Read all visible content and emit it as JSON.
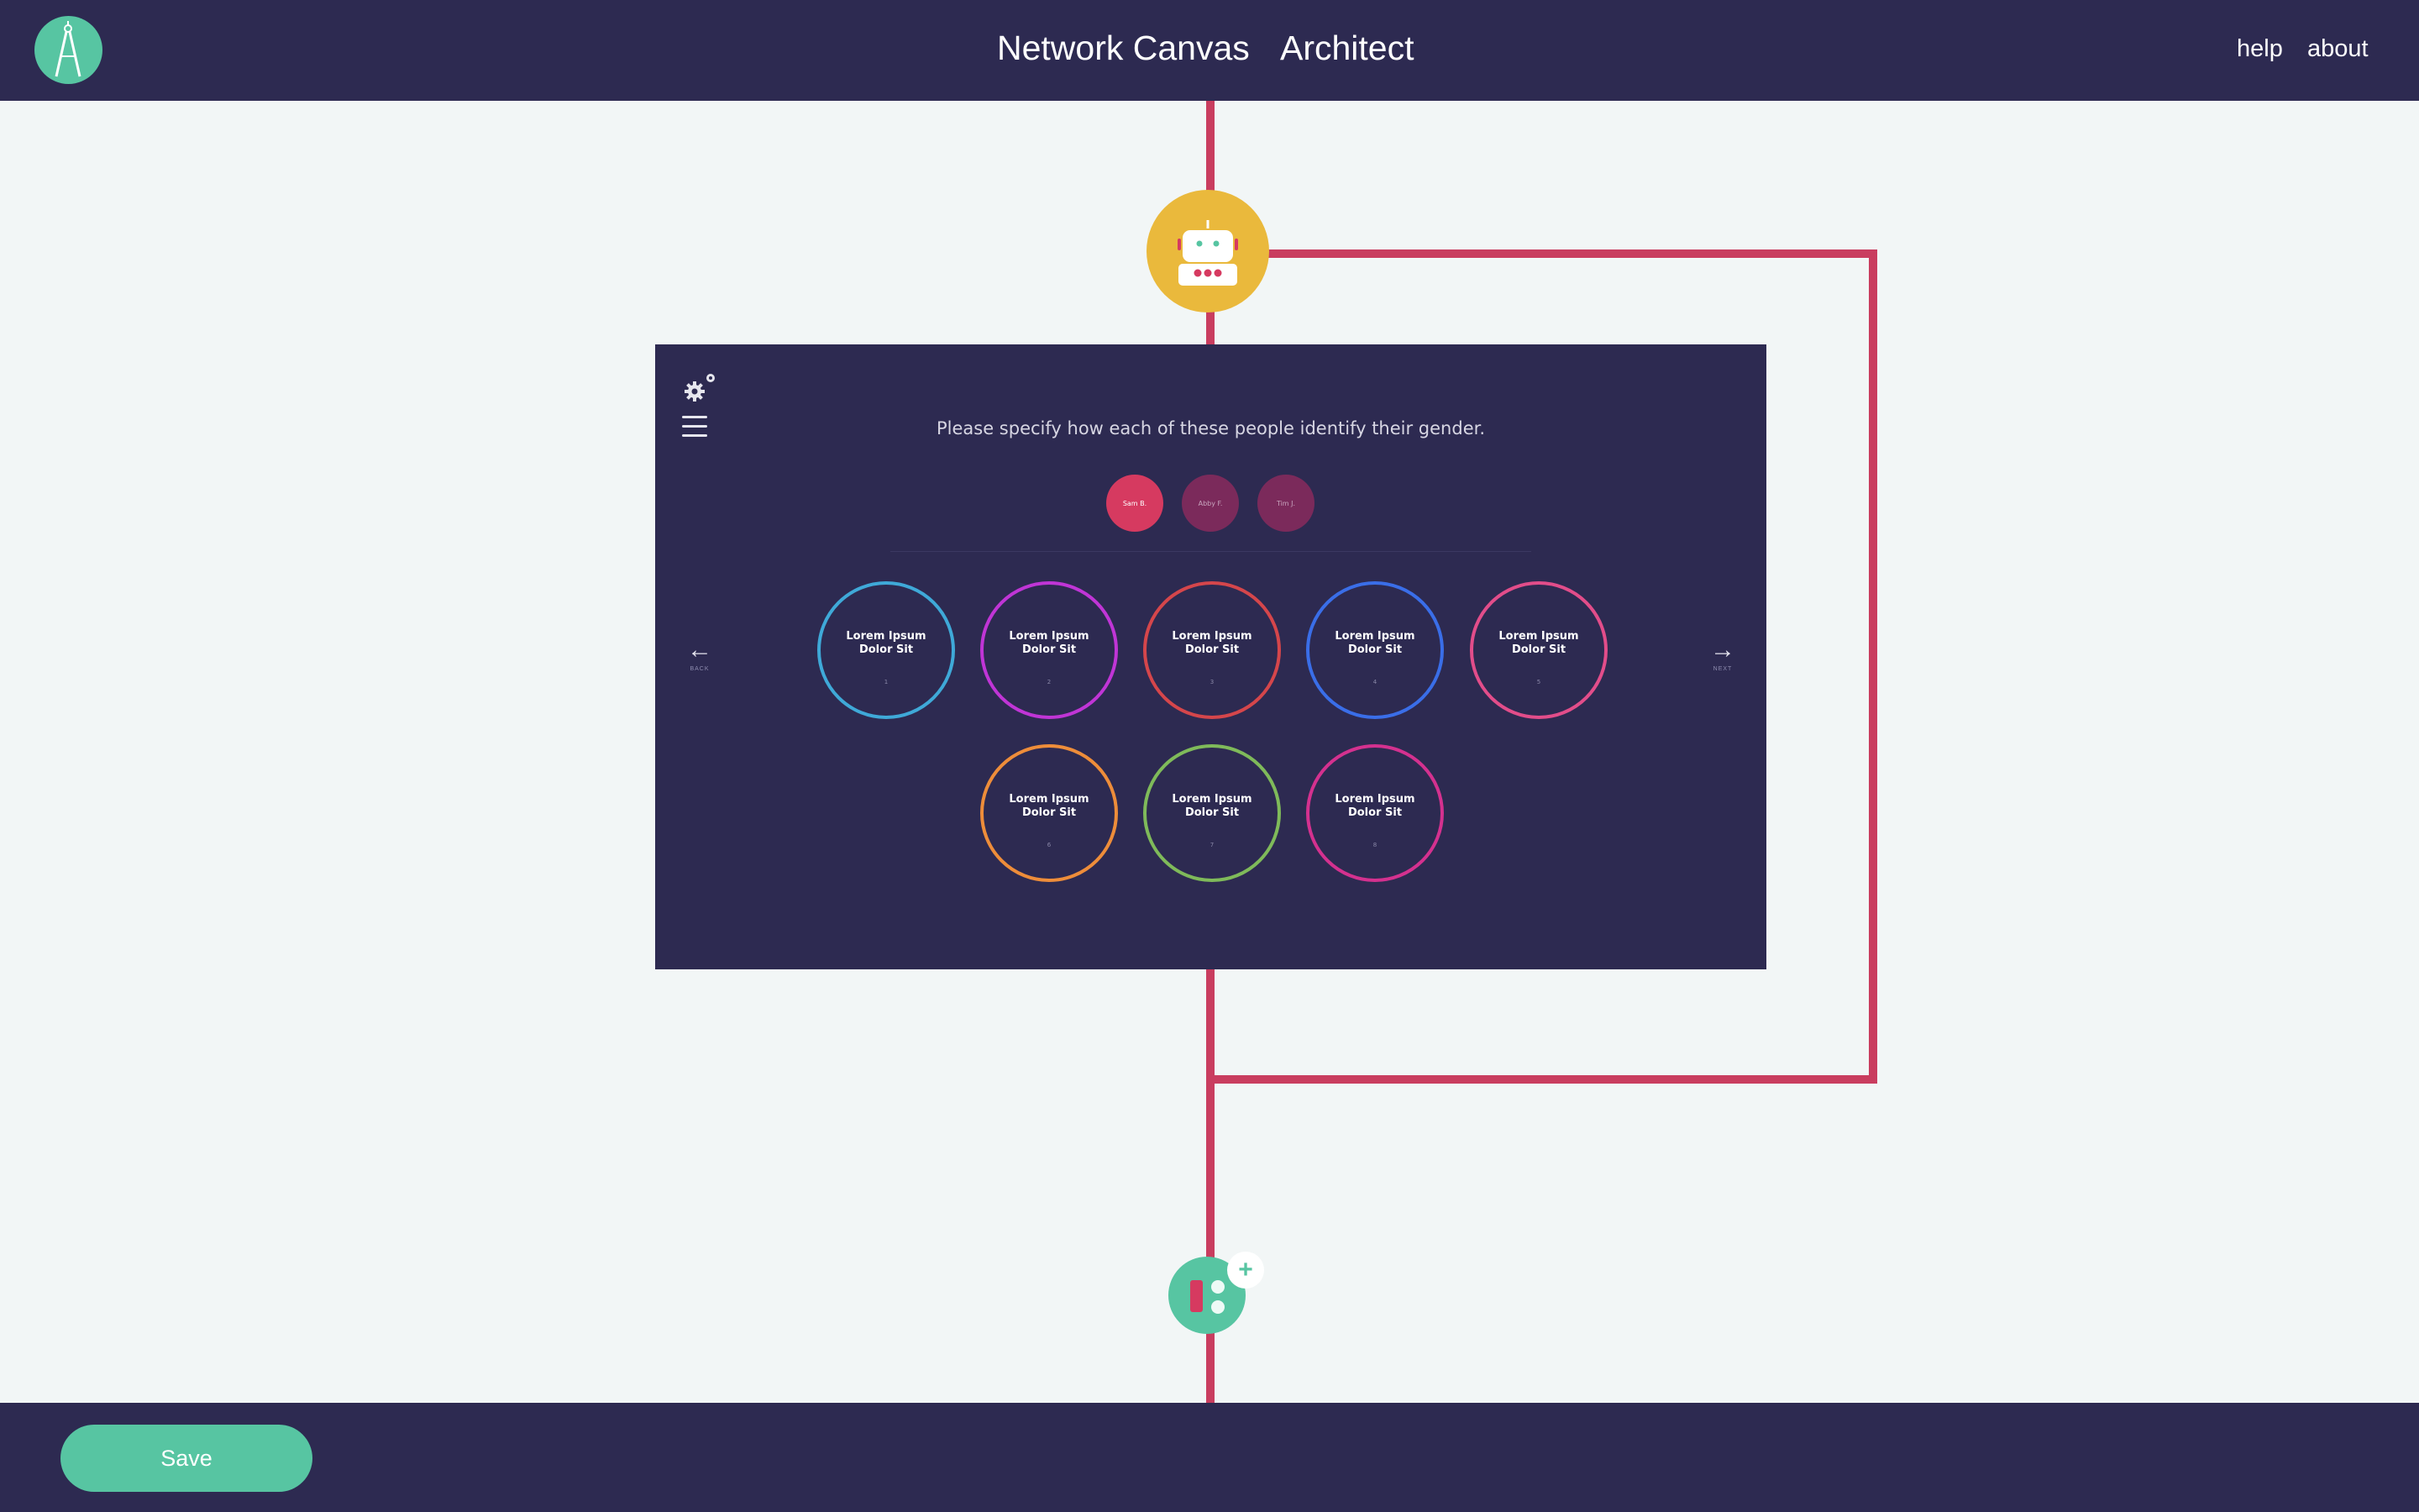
{
  "header": {
    "title_left": "Network Canvas",
    "title_right": "Architect",
    "nav": {
      "help": "help",
      "about": "about"
    }
  },
  "stage": {
    "prompt": "Please specify how each of these people identify their gender.",
    "people": [
      "Sam B.",
      "Abby F.",
      "Tim J."
    ],
    "back_label": "BACK",
    "next_label": "NEXT",
    "options": [
      {
        "label_line1": "Lorem Ipsum",
        "label_line2": "Dolor Sit",
        "index": "1",
        "color": "#3fa9d8"
      },
      {
        "label_line1": "Lorem Ipsum",
        "label_line2": "Dolor Sit",
        "index": "2",
        "color": "#c035d6"
      },
      {
        "label_line1": "Lorem Ipsum",
        "label_line2": "Dolor Sit",
        "index": "3",
        "color": "#d5464b"
      },
      {
        "label_line1": "Lorem Ipsum",
        "label_line2": "Dolor Sit",
        "index": "4",
        "color": "#3a6ee8"
      },
      {
        "label_line1": "Lorem Ipsum",
        "label_line2": "Dolor Sit",
        "index": "5",
        "color": "#e24d8a"
      },
      {
        "label_line1": "Lorem Ipsum",
        "label_line2": "Dolor Sit",
        "index": "6",
        "color": "#ee8d3a"
      },
      {
        "label_line1": "Lorem Ipsum",
        "label_line2": "Dolor Sit",
        "index": "7",
        "color": "#7fba5a"
      },
      {
        "label_line1": "Lorem Ipsum",
        "label_line2": "Dolor Sit",
        "index": "8",
        "color": "#d4318f"
      }
    ]
  },
  "footer": {
    "save_label": "Save"
  },
  "colors": {
    "navy": "#2d2a51",
    "wire": "#c93d5f",
    "accent_green": "#57c5a2",
    "accent_yellow": "#eab93c"
  },
  "icons": [
    "compass-logo-icon",
    "robot-icon",
    "gear-icon",
    "menu-icon",
    "arrow-left-icon",
    "arrow-right-icon",
    "add-stage-icon",
    "plus-icon"
  ]
}
